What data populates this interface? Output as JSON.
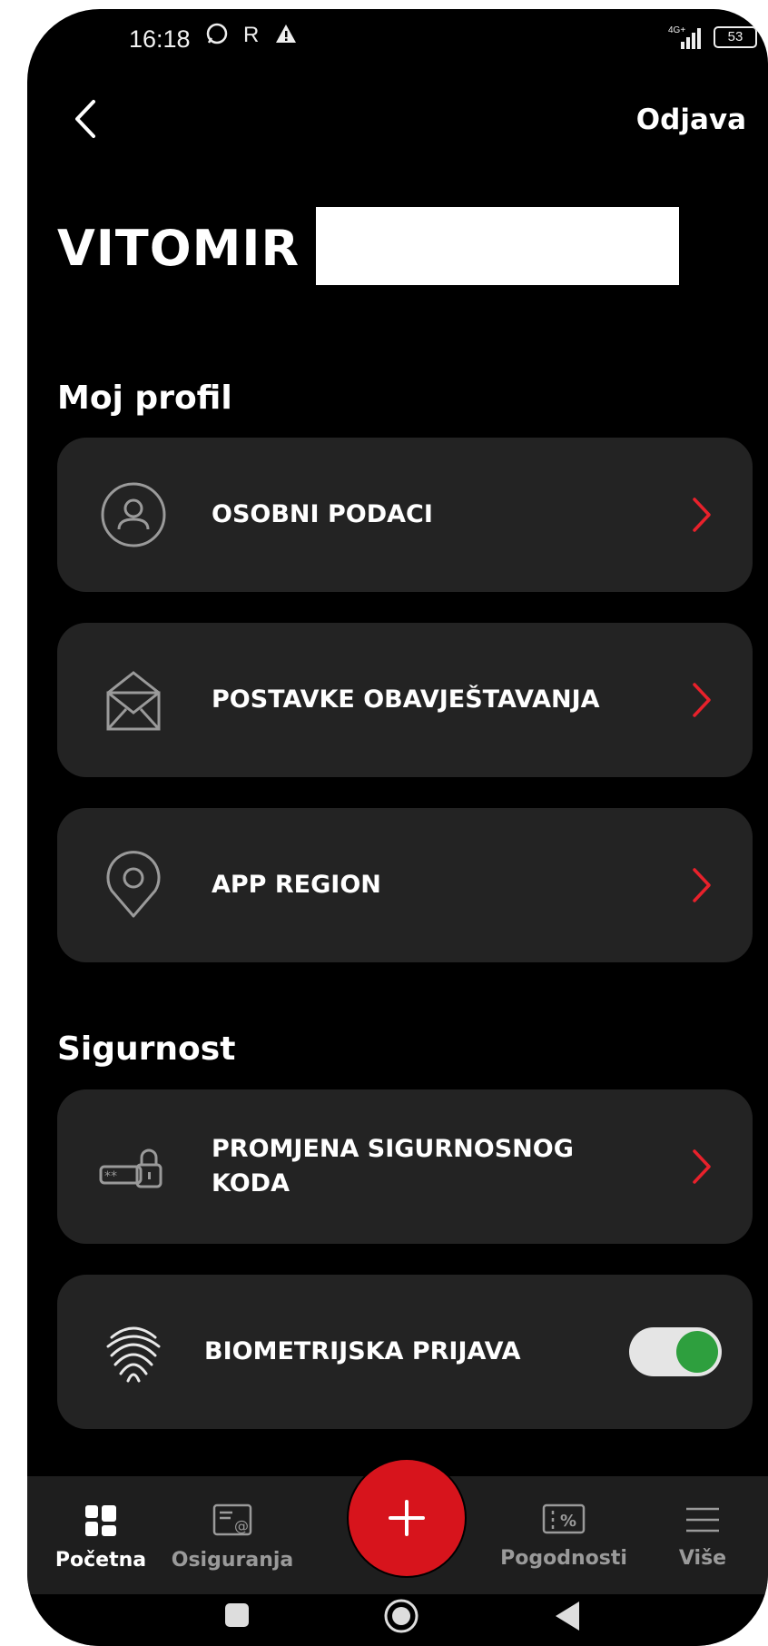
{
  "status_bar": {
    "time": "16:18",
    "network": "4G+",
    "battery": "53"
  },
  "header": {
    "logout_label": "Odjava"
  },
  "user": {
    "name": "VITOMIR"
  },
  "profile_section": {
    "title": "Moj profil",
    "items": [
      {
        "label": "OSOBNI PODACI",
        "icon": "user-icon"
      },
      {
        "label": "POSTAVKE OBAVJEŠTAVANJA",
        "icon": "mail-notification-icon"
      },
      {
        "label": "APP REGION",
        "icon": "location-pin-icon"
      }
    ]
  },
  "security_section": {
    "title": "Sigurnost",
    "items": [
      {
        "label": "PROMJENA SIGURNOSNOG KODA",
        "icon": "lock-code-icon"
      },
      {
        "label": "BIOMETRIJSKA PRIJAVA",
        "icon": "fingerprint-icon",
        "toggle_on": true
      }
    ]
  },
  "bottom_nav": {
    "items": [
      {
        "label": "Početna",
        "icon": "home-grid-icon",
        "active": true
      },
      {
        "label": "Osiguranja",
        "icon": "insurance-doc-icon",
        "active": false
      },
      {
        "label": "Pogodnosti",
        "icon": "discount-ticket-icon",
        "active": false
      },
      {
        "label": "Više",
        "icon": "menu-icon",
        "active": false
      }
    ],
    "fab_icon": "plus-icon"
  },
  "colors": {
    "accent_red": "#d7141c",
    "toggle_green": "#2e9f3e",
    "card_bg": "#232323"
  }
}
